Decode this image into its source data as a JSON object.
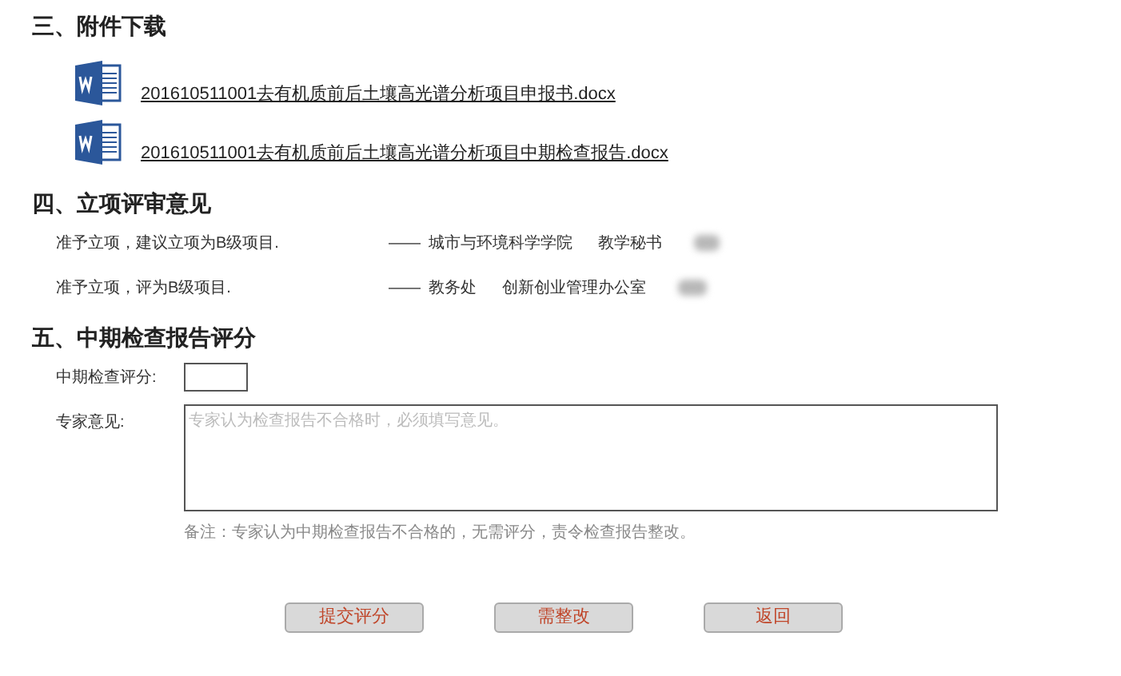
{
  "attachments": {
    "title": "三、附件下载",
    "files": [
      {
        "name": "201610511001去有机质前后土壤高光谱分析项目申报书.docx"
      },
      {
        "name": "201610511001去有机质前后土壤高光谱分析项目中期检查报告.docx"
      }
    ]
  },
  "review": {
    "title": "四、立项评审意见",
    "rows": [
      {
        "opinion": "准予立项，建议立项为B级项目.",
        "dash": "——",
        "unit": "城市与环境科学学院",
        "role": "教学秘书"
      },
      {
        "opinion": "准予立项，评为B级项目.",
        "dash": "——",
        "unit": "教务处",
        "role": "创新创业管理办公室"
      }
    ]
  },
  "scoring": {
    "title": "五、中期检查报告评分",
    "score_label": "中期检查评分:",
    "comment_label": "专家意见:",
    "comment_placeholder": "专家认为检查报告不合格时，必须填写意见。",
    "note": "备注：专家认为中期检查报告不合格的，无需评分，责令检查报告整改。"
  },
  "buttons": [
    "提交评分",
    "需整改",
    "返回"
  ]
}
